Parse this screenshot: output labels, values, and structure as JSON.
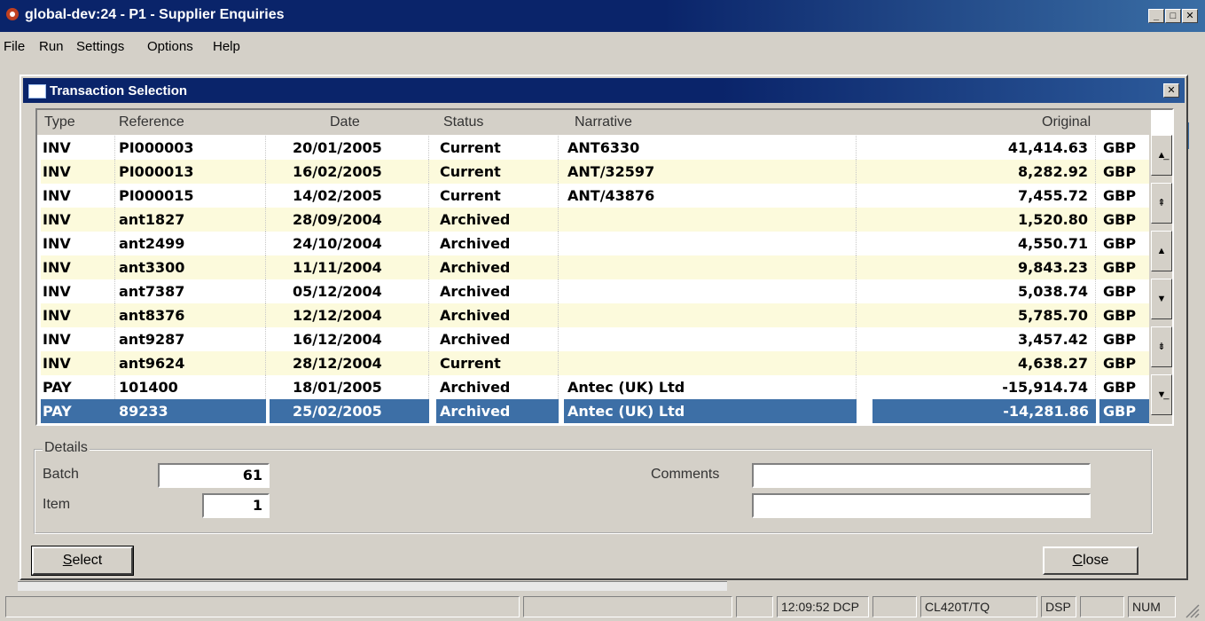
{
  "window": {
    "title": "global-dev:24 - P1 - Supplier Enquiries",
    "controls": [
      "minimize-icon",
      "maximize-icon",
      "close-icon"
    ]
  },
  "menu": {
    "items": [
      "File",
      "Run",
      "Settings",
      "Options",
      "Help"
    ]
  },
  "dialog": {
    "title": "Transaction Selection",
    "columns": {
      "type": "Type",
      "reference": "Reference",
      "date": "Date",
      "status": "Status",
      "narrative": "Narrative",
      "original": "Original"
    },
    "rows": [
      {
        "type": "INV",
        "reference": "PI000003",
        "date": "20/01/2005",
        "status": "Current",
        "narrative": "ANT6330",
        "original": "41,414.63",
        "currency": "GBP"
      },
      {
        "type": "INV",
        "reference": "PI000013",
        "date": "16/02/2005",
        "status": "Current",
        "narrative": "ANT/32597",
        "original": "8,282.92",
        "currency": "GBP"
      },
      {
        "type": "INV",
        "reference": "PI000015",
        "date": "14/02/2005",
        "status": "Current",
        "narrative": "ANT/43876",
        "original": "7,455.72",
        "currency": "GBP"
      },
      {
        "type": "INV",
        "reference": "ant1827",
        "date": "28/09/2004",
        "status": "Archived",
        "narrative": "",
        "original": "1,520.80",
        "currency": "GBP"
      },
      {
        "type": "INV",
        "reference": "ant2499",
        "date": "24/10/2004",
        "status": "Archived",
        "narrative": "",
        "original": "4,550.71",
        "currency": "GBP"
      },
      {
        "type": "INV",
        "reference": "ant3300",
        "date": "11/11/2004",
        "status": "Archived",
        "narrative": "",
        "original": "9,843.23",
        "currency": "GBP"
      },
      {
        "type": "INV",
        "reference": "ant7387",
        "date": "05/12/2004",
        "status": "Archived",
        "narrative": "",
        "original": "5,038.74",
        "currency": "GBP"
      },
      {
        "type": "INV",
        "reference": "ant8376",
        "date": "12/12/2004",
        "status": "Archived",
        "narrative": "",
        "original": "5,785.70",
        "currency": "GBP"
      },
      {
        "type": "INV",
        "reference": "ant9287",
        "date": "16/12/2004",
        "status": "Archived",
        "narrative": "",
        "original": "3,457.42",
        "currency": "GBP"
      },
      {
        "type": "INV",
        "reference": "ant9624",
        "date": "28/12/2004",
        "status": "Current",
        "narrative": "",
        "original": "4,638.27",
        "currency": "GBP"
      },
      {
        "type": "PAY",
        "reference": "101400",
        "date": "18/01/2005",
        "status": "Archived",
        "narrative": "Antec (UK) Ltd",
        "original": "-15,914.74",
        "currency": "GBP"
      },
      {
        "type": "PAY",
        "reference": "89233",
        "date": "25/02/2005",
        "status": "Archived",
        "narrative": "Antec (UK) Ltd",
        "original": "-14,281.86",
        "currency": "GBP",
        "selected": true
      }
    ],
    "details": {
      "legend": "Details",
      "batch_label": "Batch",
      "batch_value": "61",
      "item_label": "Item",
      "item_value": "1",
      "comments_label": "Comments",
      "comments_line1": "",
      "comments_line2": ""
    },
    "buttons": {
      "select": "Select",
      "close": "Close"
    }
  },
  "statusbar": {
    "time": "12:09:52",
    "dcp": "DCP",
    "code": "CL420T/TQ",
    "dsp": "DSP",
    "num": "NUM"
  },
  "colors": {
    "title_blue": "#0a246a",
    "row_highlight": "#fcfadc",
    "selection": "#3d6fa6"
  }
}
